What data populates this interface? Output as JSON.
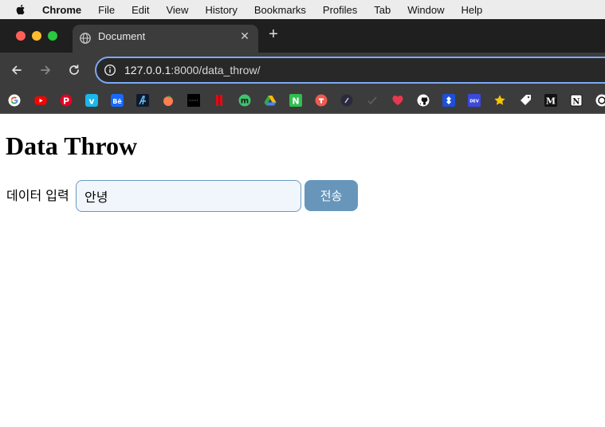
{
  "menubar": {
    "app": "Chrome",
    "items": [
      "File",
      "Edit",
      "View",
      "History",
      "Bookmarks",
      "Profiles",
      "Tab",
      "Window",
      "Help"
    ]
  },
  "tab": {
    "title": "Document"
  },
  "toolbar": {
    "url_host": "127.0.0.1",
    "url_path": ":8000/data_throw/"
  },
  "bookmarks": [
    {
      "icon": "google-icon",
      "color": "#ffffff"
    },
    {
      "icon": "youtube-icon",
      "color": "#ff0000"
    },
    {
      "icon": "pinterest-icon",
      "color": "#e60023"
    },
    {
      "icon": "vimeo-icon",
      "color": "#1ab7ea"
    },
    {
      "icon": "behance-icon",
      "color": "#1769ff"
    },
    {
      "icon": "affinity-icon",
      "color": "#0e1a2b"
    },
    {
      "icon": "peach-icon",
      "color": "#ff7f50"
    },
    {
      "icon": "dark-stripe-icon",
      "color": "#000000"
    },
    {
      "icon": "netflix-icon",
      "color": "#e50914"
    },
    {
      "icon": "m-circle-icon",
      "color": "#3ec46d"
    },
    {
      "icon": "google-drive-icon",
      "color": "#34a853"
    },
    {
      "icon": "n-square-icon",
      "color": "#2fbf4f"
    },
    {
      "icon": "red-circle-icon",
      "color": "#f05a4f"
    },
    {
      "icon": "slash-circle-icon",
      "color": "#2a2a3a"
    },
    {
      "icon": "checkmark-icon",
      "color": "#555555"
    },
    {
      "icon": "heart-icon",
      "color": "#e8384f"
    },
    {
      "icon": "github-icon",
      "color": "#ffffff"
    },
    {
      "icon": "jira-icon",
      "color": "#2684ff"
    },
    {
      "icon": "dev-icon",
      "color": "#3b49df"
    },
    {
      "icon": "star-icon",
      "color": "#f7c600"
    },
    {
      "icon": "tag-icon",
      "color": "#ffffff"
    },
    {
      "icon": "medium-icon",
      "color": "#111111"
    },
    {
      "icon": "notion-icon",
      "color": "#ffffff"
    },
    {
      "icon": "openai-icon",
      "color": "#ffffff"
    }
  ],
  "page": {
    "heading": "Data Throw",
    "input_label": "데이터 입력",
    "input_value": "안녕",
    "submit_label": "전송"
  },
  "colors": {
    "input_border": "#6b98bd",
    "input_bg": "#f1f6fd",
    "button_bg": "#6896bb",
    "omnibox_focus": "#7ca9f4"
  }
}
